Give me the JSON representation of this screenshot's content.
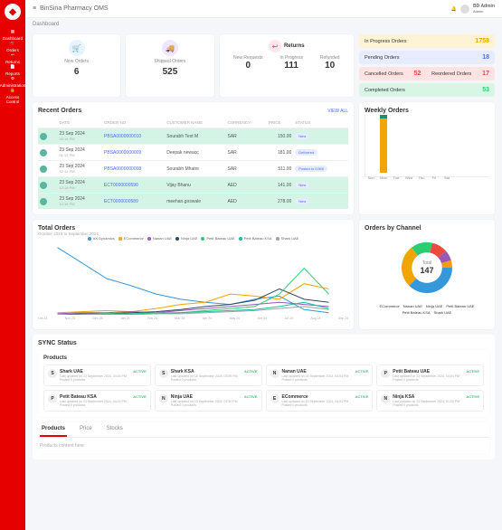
{
  "app_title": "BinSina Pharmacy OMS",
  "user": {
    "name": "BD Admin",
    "role": "Admin"
  },
  "breadcrumb": "Dashboard",
  "nav": [
    {
      "icon": "grid",
      "label": "Dashboard"
    },
    {
      "icon": "cart",
      "label": "Orders"
    },
    {
      "icon": "return",
      "label": "Returns"
    },
    {
      "icon": "report",
      "label": "Reports"
    },
    {
      "icon": "admin",
      "label": "Administration"
    },
    {
      "icon": "lock",
      "label": "Access Control"
    }
  ],
  "stats": {
    "new_orders": {
      "label": "New Orders",
      "value": "6"
    },
    "shipped": {
      "label": "Shipped Orders",
      "value": "525"
    },
    "returns_title": "Returns",
    "returns": [
      {
        "label": "New Requests",
        "value": "0"
      },
      {
        "label": "In Progress",
        "value": "111"
      },
      {
        "label": "Refunded",
        "value": "10"
      }
    ]
  },
  "status_rows": [
    {
      "label": "In Progress Orders",
      "value": "1758",
      "bg": "#fff3d6",
      "color": "#f0a500"
    },
    {
      "label": "Pending Orders",
      "value": "18",
      "bg": "#e8ecff",
      "color": "#4a6cf7"
    },
    {
      "label_a": "Cancelled Orders",
      "value_a": "52",
      "label_b": "Reordered Orders",
      "value_b": "17",
      "bg": "#ffe3e3",
      "color": "#e74c3c",
      "split": true
    },
    {
      "label": "Completed Orders",
      "value": "53",
      "bg": "#d9f5e6",
      "color": "#2ecc71"
    }
  ],
  "recent": {
    "title": "Recent Orders",
    "viewall": "VIEW ALL",
    "headers": [
      "DATE",
      "ORDER NO",
      "CUSTOMER NAME",
      "CURRENCY",
      "PRICE",
      "STATUS"
    ],
    "rows": [
      {
        "date": "23 Sep 2024",
        "time": "03:14 PM",
        "order": "PBSA0000000010",
        "customer": "Sourabh Test M",
        "currency": "SAR",
        "price": "150.00",
        "status": "New",
        "hl": true
      },
      {
        "date": "23 Sep 2024",
        "time": "01:13 PM",
        "order": "PBSA0000000009",
        "customer": "Deepak newacc",
        "currency": "SAR",
        "price": "181.00",
        "status": "Delivered"
      },
      {
        "date": "23 Sep 2024",
        "time": "12:19 PM",
        "order": "PBSA0000000008",
        "customer": "Sourabh Mhatre",
        "currency": "SAR",
        "price": "511.00",
        "status": "Posted to D365"
      },
      {
        "date": "23 Sep 2024",
        "time": "12:18 PM",
        "order": "ECT0000000590",
        "customer": "Vijay Bhanu",
        "currency": "AED",
        "price": "141.00",
        "status": "New",
        "hl": true
      },
      {
        "date": "23 Sep 2024",
        "time": "12:16 PM",
        "order": "ECT0000000589",
        "customer": "meehan.goswale",
        "currency": "AED",
        "price": "278.00",
        "status": "New",
        "hl": true
      }
    ]
  },
  "weekly": {
    "title": "Weekly Orders",
    "days": [
      "Sun",
      "Mon",
      "Tue",
      "Wed",
      "Thu",
      "Fri",
      "Sat"
    ]
  },
  "total_orders": {
    "title": "Total Orders",
    "sub": "October 2023 to September 2024",
    "series": [
      "AX Dynamics",
      "ECommerce",
      "Nanan UAE",
      "Ninja UAE",
      "Petit Bateau UAE",
      "Petit Bateau KSA",
      "Shark UAE"
    ],
    "colors": [
      "#3498db",
      "#f0a500",
      "#9b59b6",
      "#34495e",
      "#2ecc71",
      "#1abc9c",
      "#95a5a6"
    ],
    "months": [
      "Oct 23",
      "Nov 23",
      "Dec 23",
      "Jan 24",
      "Feb 24",
      "Mar 24",
      "Apr 24",
      "May 24",
      "Jun 24",
      "Jul 24",
      "Aug 24",
      "Sep 24"
    ]
  },
  "channels": {
    "title": "Orders by Channel",
    "total_label": "Total",
    "total": "147",
    "items": [
      {
        "name": "ECommerce",
        "color": "#3498db"
      },
      {
        "name": "Nanan UAE",
        "color": "#f0a500"
      },
      {
        "name": "Ninja UAE",
        "color": "#2ecc71"
      },
      {
        "name": "Petit Bateau UAE",
        "color": "#e74c3c"
      },
      {
        "name": "Petit Bateau KSA",
        "color": "#9b59b6"
      },
      {
        "name": "Shark UAE",
        "color": "#f39c12"
      }
    ]
  },
  "sync": {
    "title": "SYNC Status",
    "sub": "Products",
    "items": [
      {
        "icon": "S",
        "name": "Shark UAE",
        "meta": "Last updated on 23 September 2024, 04:04 PM",
        "meta2": "Posted 0 products",
        "status": "ACTIVE"
      },
      {
        "icon": "S",
        "name": "Shark KSA",
        "meta": "Last updated on 18 September 2024, 03:59 PM",
        "meta2": "Posted 0 products",
        "status": "ACTIVE"
      },
      {
        "icon": "N",
        "name": "Nanan UAE",
        "meta": "Last updated on 23 September 2024, 04:04 PM",
        "meta2": "Posted 0 products",
        "status": "ACTIVE"
      },
      {
        "icon": "P",
        "name": "Petit Bateau UAE",
        "meta": "Last updated on 23 September 2024, 04:04 PM",
        "meta2": "Posted 0 products",
        "status": "ACTIVE"
      },
      {
        "icon": "P",
        "name": "Petit Bateau KSA",
        "meta": "Last updated on 23 September 2024, 04:04 PM",
        "meta2": "Posted 0 products",
        "status": "ACTIVE"
      },
      {
        "icon": "N",
        "name": "Ninja UAE",
        "meta": "Last updated on 23 September 2024, 01:50 PM",
        "meta2": "Posted 0 products",
        "status": "ACTIVE"
      },
      {
        "icon": "E",
        "name": "ECommerce",
        "meta": "Last updated on 23 September 2024, 04:04 PM",
        "meta2": "Posted 0 products",
        "status": "ACTIVE"
      },
      {
        "icon": "N",
        "name": "Ninja KSA",
        "meta": "Last updated on 23 September 2024, 01:50 PM",
        "meta2": "Posted 0 products",
        "status": "ACTIVE"
      }
    ]
  },
  "bottom_tabs": {
    "tabs": [
      "Products",
      "Price",
      "Stocks"
    ],
    "content": "Products content here"
  },
  "chart_data": {
    "weekly": {
      "type": "bar",
      "categories": [
        "Sun",
        "Mon",
        "Tue",
        "Wed",
        "Thu",
        "Fri",
        "Sat"
      ],
      "values": [
        0,
        6,
        0,
        0,
        0,
        0,
        0
      ],
      "ylim": [
        0,
        6
      ],
      "stacked_top": 1
    },
    "total_orders": {
      "type": "line",
      "x": [
        "Oct 23",
        "Nov 23",
        "Dec 23",
        "Jan 24",
        "Feb 24",
        "Mar 24",
        "Apr 24",
        "May 24",
        "Jun 24",
        "Jul 24",
        "Aug 24",
        "Sep 24"
      ],
      "series": [
        {
          "name": "AX Dynamics",
          "color": "#3498db",
          "values": [
            65,
            50,
            35,
            28,
            20,
            15,
            12,
            10,
            15,
            18,
            5,
            2
          ]
        },
        {
          "name": "ECommerce",
          "color": "#f0a500",
          "values": [
            2,
            3,
            4,
            3,
            6,
            10,
            12,
            20,
            18,
            15,
            30,
            25
          ]
        },
        {
          "name": "Nanan UAE",
          "color": "#9b59b6",
          "values": [
            1,
            2,
            2,
            3,
            2,
            4,
            6,
            8,
            10,
            12,
            10,
            8
          ]
        },
        {
          "name": "Ninja UAE",
          "color": "#34495e",
          "values": [
            0,
            1,
            1,
            2,
            3,
            5,
            8,
            10,
            14,
            25,
            15,
            12
          ]
        },
        {
          "name": "Petit Bateau UAE",
          "color": "#2ecc71",
          "values": [
            0,
            0,
            1,
            1,
            2,
            2,
            4,
            6,
            8,
            20,
            45,
            20
          ]
        },
        {
          "name": "Petit Bateau KSA",
          "color": "#1abc9c",
          "values": [
            0,
            0,
            0,
            1,
            1,
            2,
            3,
            4,
            5,
            8,
            12,
            6
          ]
        },
        {
          "name": "Shark UAE",
          "color": "#95a5a6",
          "values": [
            0,
            0,
            0,
            0,
            1,
            1,
            2,
            3,
            4,
            6,
            8,
            5
          ]
        }
      ],
      "ylim": [
        0,
        70
      ]
    },
    "channels": {
      "type": "pie",
      "total": 147,
      "slices": [
        {
          "name": "ECommerce",
          "value": 55,
          "color": "#3498db"
        },
        {
          "name": "Nanan UAE",
          "value": 40,
          "color": "#f0a500"
        },
        {
          "name": "Ninja UAE",
          "value": 20,
          "color": "#2ecc71"
        },
        {
          "name": "Petit Bateau UAE",
          "value": 15,
          "color": "#e74c3c"
        },
        {
          "name": "Petit Bateau KSA",
          "value": 10,
          "color": "#9b59b6"
        },
        {
          "name": "Shark UAE",
          "value": 7,
          "color": "#f39c12"
        }
      ]
    }
  }
}
